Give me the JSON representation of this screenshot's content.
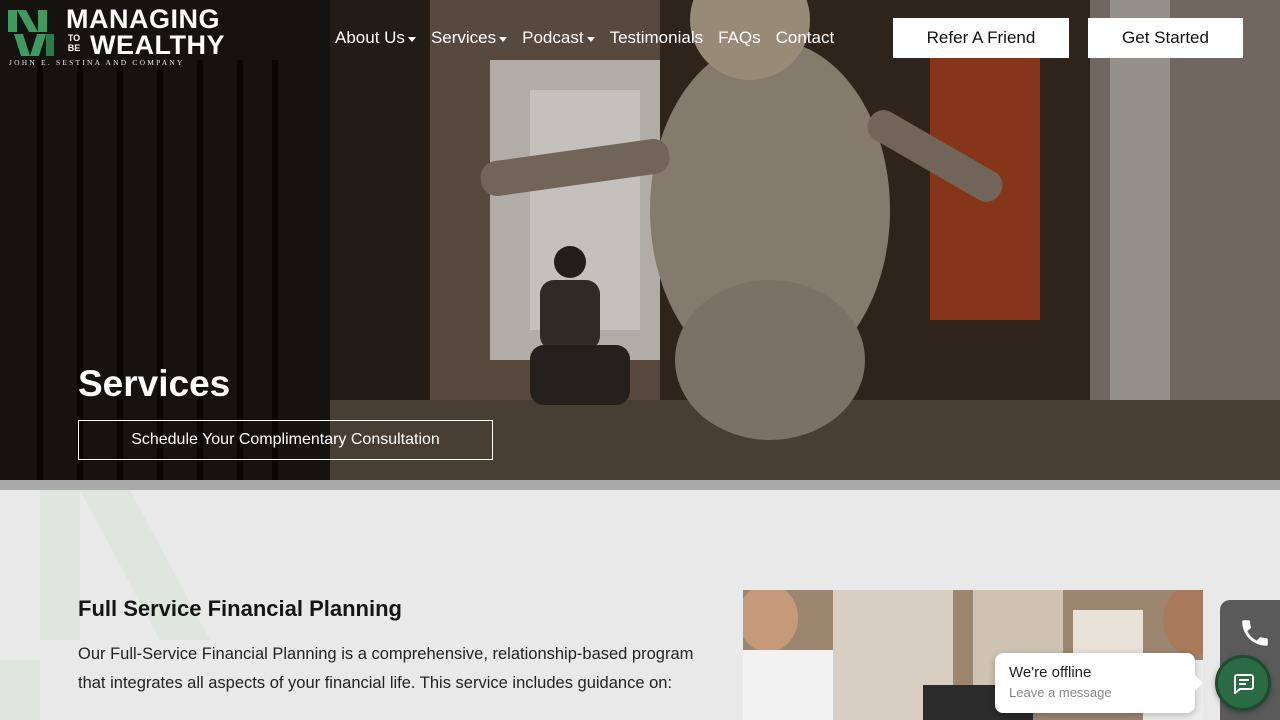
{
  "brand": {
    "line1": "MANAGING",
    "to_be": "TO BE",
    "line2": "WEALTHY",
    "subline": "JOHN E. SESTINA AND COMPANY"
  },
  "nav": {
    "items": [
      {
        "label": "About Us",
        "dropdown": true
      },
      {
        "label": "Services",
        "dropdown": true
      },
      {
        "label": "Podcast",
        "dropdown": true
      },
      {
        "label": "Testimonials",
        "dropdown": false
      },
      {
        "label": "FAQs",
        "dropdown": false
      },
      {
        "label": "Contact",
        "dropdown": false
      }
    ],
    "refer_label": "Refer A Friend",
    "start_label": "Get Started"
  },
  "hero": {
    "title": "Services",
    "cta_label": "Schedule Your Complimentary Consultation"
  },
  "section": {
    "title": "Full Service Financial Planning",
    "body": "Our Full-Service Financial Planning is a comprehensive, relationship-based program that integrates all aspects of your financial life. This service includes guidance on:"
  },
  "chat": {
    "title": "We're offline",
    "subtitle": "Leave a message"
  },
  "colors": {
    "brand_green": "#2a6b45",
    "logo_green": "#3e9a61"
  }
}
